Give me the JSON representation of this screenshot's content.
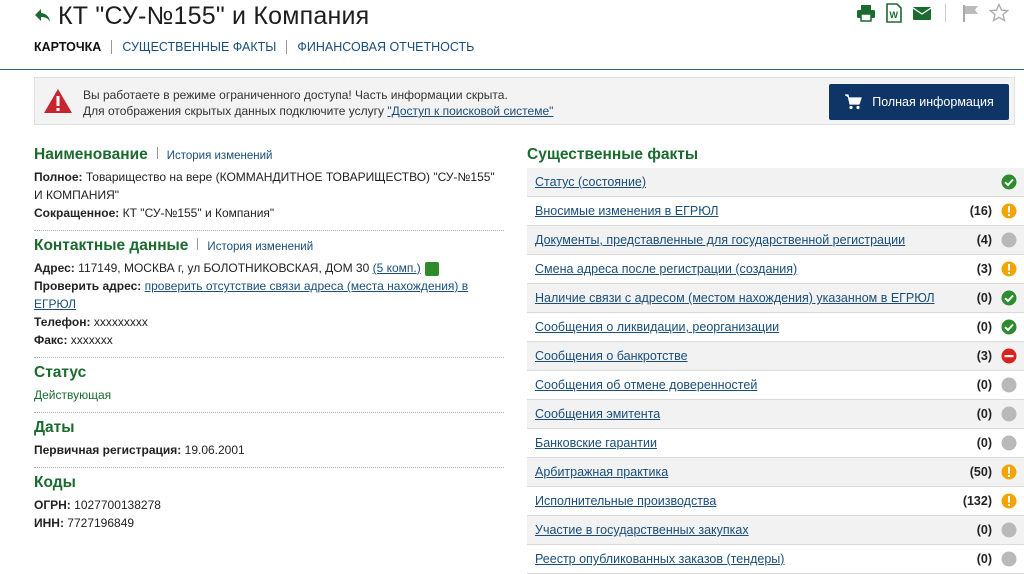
{
  "header": {
    "title": "КТ \"СУ-№155\" и Компания",
    "tabs": [
      {
        "label": "КАРТОЧКА",
        "active": true
      },
      {
        "label": "СУЩЕСТВЕННЫЕ ФАКТЫ",
        "active": false
      },
      {
        "label": "ФИНАНСОВАЯ ОТЧЕТНОСТЬ",
        "active": false
      }
    ],
    "tools": [
      "print-icon",
      "word-icon",
      "mail-icon",
      "flag-icon",
      "star-icon"
    ]
  },
  "alert": {
    "line1": "Вы работаете в режиме ограниченного доступа! Часть информации скрыта.",
    "line2_prefix": "Для отображения скрытых данных подключите услугу ",
    "line2_link": "\"Доступ к поисковой системе\"",
    "button": "Полная информация"
  },
  "name_section": {
    "title": "Наименование",
    "history": "История изменений",
    "full_label": "Полное:",
    "full_value": "Товарищество на вере (КОММАНДИТНОЕ ТОВАРИЩЕСТВО) \"СУ-№155\" И КОМПАНИЯ\"",
    "short_label": "Сокращенное:",
    "short_value": "КТ \"СУ-№155\" и Компания\""
  },
  "contacts": {
    "title": "Контактные данные",
    "history": "История изменений",
    "address_label": "Адрес:",
    "address_value": "117149, МОСКВА г, ул БОЛОТНИКОВСКАЯ, ДОМ 30",
    "address_link": "(5 комп.)",
    "check_label": "Проверить адрес:",
    "check_link": "проверить отсутствие связи адреса (места нахождения) в ЕГРЮЛ",
    "phone_label": "Телефон:",
    "phone_value": "xxxxxxxxx",
    "fax_label": "Факс:",
    "fax_value": "xxxxxxx"
  },
  "status": {
    "title": "Статус",
    "value": "Действующая"
  },
  "dates": {
    "title": "Даты",
    "reg_label": "Первичная регистрация:",
    "reg_value": "19.06.2001"
  },
  "codes": {
    "title": "Коды",
    "ogrn_label": "ОГРН:",
    "ogrn_value": "1027700138278",
    "inn_label": "ИНН:",
    "inn_value": "7727196849"
  },
  "facts": {
    "title": "Существенные факты",
    "items": [
      {
        "label": "Статус (состояние)",
        "count": "",
        "status": "ok"
      },
      {
        "label": "Вносимые изменения в ЕГРЮЛ",
        "count": "(16)",
        "status": "warn"
      },
      {
        "label": "Документы, представленные для государственной регистрации",
        "count": "(4)",
        "status": "none"
      },
      {
        "label": "Смена адреса после регистрации (создания)",
        "count": "(3)",
        "status": "warn"
      },
      {
        "label": "Наличие связи с адресом (местом нахождения) указанном в ЕГРЮЛ",
        "count": "(0)",
        "status": "ok"
      },
      {
        "label": "Сообщения о ликвидации, реорганизации",
        "count": "(0)",
        "status": "ok"
      },
      {
        "label": "Сообщения о банкротстве",
        "count": "(3)",
        "status": "stop"
      },
      {
        "label": "Сообщения об отмене доверенностей",
        "count": "(0)",
        "status": "none"
      },
      {
        "label": "Сообщения эмитента",
        "count": "(0)",
        "status": "none"
      },
      {
        "label": "Банковские гарантии",
        "count": "(0)",
        "status": "none"
      },
      {
        "label": "Арбитражная практика",
        "count": "(50)",
        "status": "warn"
      },
      {
        "label": "Исполнительные производства",
        "count": "(132)",
        "status": "warn"
      },
      {
        "label": "Участие в государственных закупках",
        "count": "(0)",
        "status": "none"
      },
      {
        "label": "Реестр опубликованных заказов (тендеры)",
        "count": "(0)",
        "status": "none"
      }
    ]
  },
  "colors": {
    "brand_green": "#1b6b2f",
    "link_blue": "#1a4e7a",
    "button_navy": "#0f3566",
    "ok": "#2e8b2e",
    "warn": "#f2a500",
    "stop": "#d9231d",
    "none": "#b9b9b9"
  }
}
